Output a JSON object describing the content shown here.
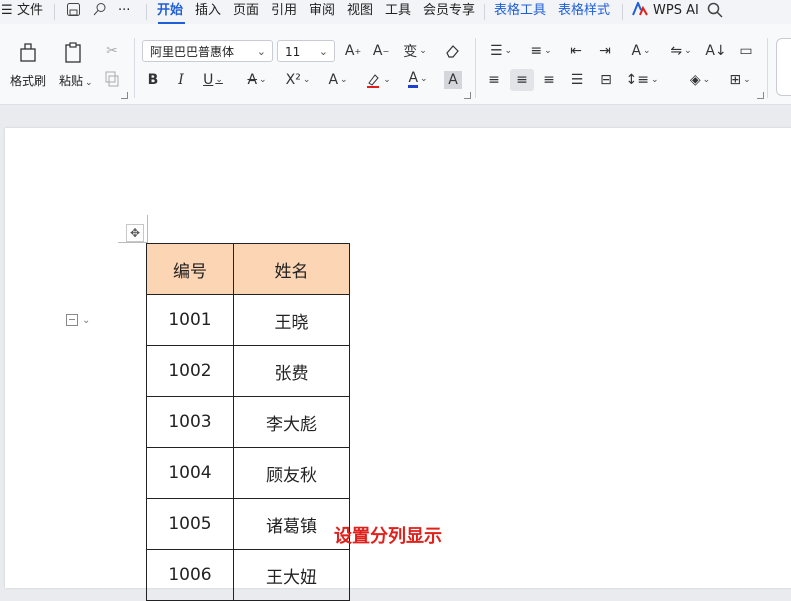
{
  "menu": {
    "file": "文件",
    "tabs": [
      "开始",
      "插入",
      "页面",
      "引用",
      "审阅",
      "视图",
      "工具",
      "会员专享"
    ],
    "context_tabs": [
      "表格工具",
      "表格样式"
    ],
    "ai": "WPS AI"
  },
  "ribbon": {
    "format_painter": "格式刷",
    "paste": "粘贴",
    "font_name": "阿里巴巴普惠体",
    "font_size": "11"
  },
  "table": {
    "headers": [
      "编号",
      "姓名"
    ],
    "rows": [
      [
        "1001",
        "王晓"
      ],
      [
        "1002",
        "张费"
      ],
      [
        "1003",
        "李大彪"
      ],
      [
        "1004",
        "顾友秋"
      ],
      [
        "1005",
        "诸葛镇"
      ],
      [
        "1006",
        "王大妞"
      ]
    ],
    "header_color": "#fcd5b4"
  },
  "annotation": "设置分列显示",
  "colors": {
    "accent": "#1f5fd7",
    "annotation": "#e0201b"
  }
}
